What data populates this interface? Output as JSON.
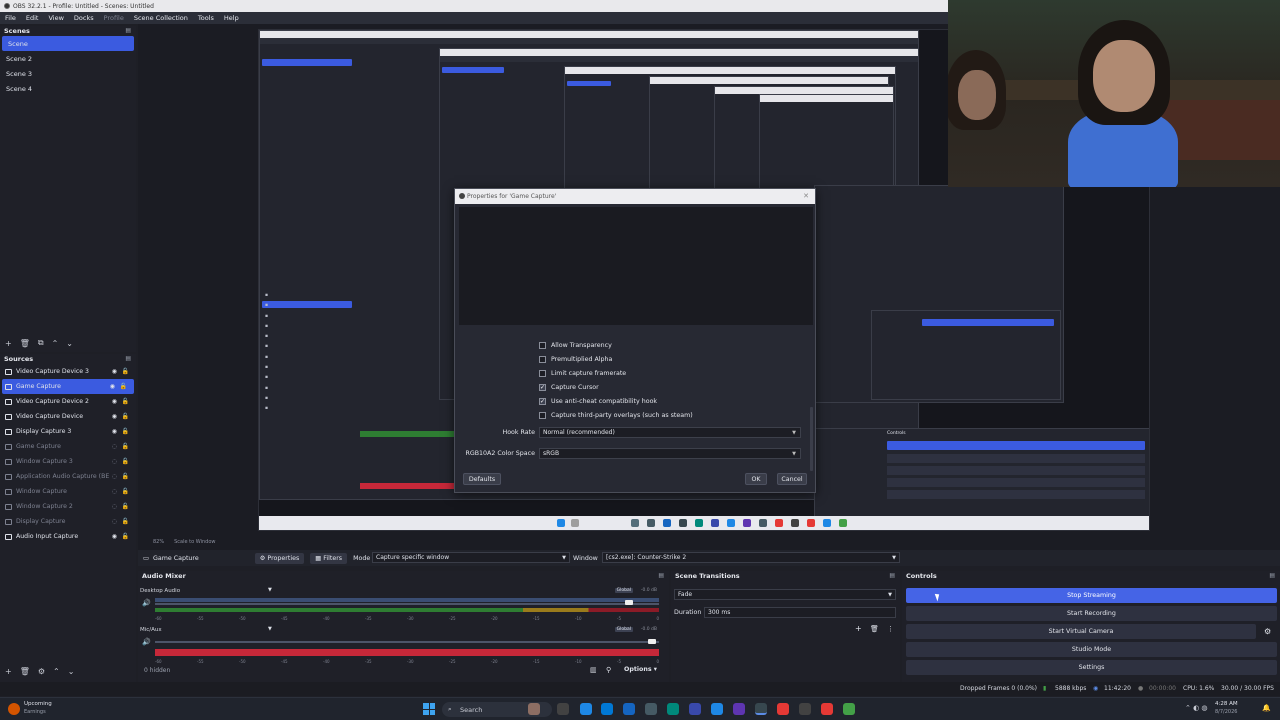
{
  "window": {
    "title": "OBS 32.2.1 - Profile: Untitled - Scenes: Untitled"
  },
  "menu": [
    "File",
    "Edit",
    "View",
    "Docks",
    "Profile",
    "Scene Collection",
    "Tools",
    "Help"
  ],
  "scenes": {
    "title": "Scenes",
    "items": [
      "Scene",
      "Scene 2",
      "Scene 3",
      "Scene 4"
    ],
    "selected": 0
  },
  "sources": {
    "title": "Sources",
    "items": [
      {
        "label": "Video Capture Device 3",
        "visible": true
      },
      {
        "label": "Game Capture",
        "visible": true,
        "selected": true
      },
      {
        "label": "Video Capture Device 2",
        "visible": true
      },
      {
        "label": "Video Capture Device",
        "visible": true
      },
      {
        "label": "Display Capture 3",
        "visible": true
      },
      {
        "label": "Game Capture",
        "visible": false
      },
      {
        "label": "Window Capture 3",
        "visible": false
      },
      {
        "label": "Application Audio Capture (BE",
        "visible": false
      },
      {
        "label": "Window Capture",
        "visible": false
      },
      {
        "label": "Window Capture 2",
        "visible": false
      },
      {
        "label": "Display Capture",
        "visible": false
      },
      {
        "label": "Audio Input Capture",
        "visible": true
      }
    ]
  },
  "dialog": {
    "title": "Properties for 'Game Capture'",
    "checkboxes": [
      {
        "label": "Allow Transparency",
        "checked": false
      },
      {
        "label": "Premultiplied Alpha",
        "checked": false
      },
      {
        "label": "Limit capture framerate",
        "checked": false
      },
      {
        "label": "Capture Cursor",
        "checked": true
      },
      {
        "label": "Use anti-cheat compatibility hook",
        "checked": true
      },
      {
        "label": "Capture third-party overlays (such as steam)",
        "checked": false
      }
    ],
    "hook_rate_label": "Hook Rate",
    "hook_rate_value": "Normal (recommended)",
    "color_space_label": "RGB10A2 Color Space",
    "color_space_value": "sRGB",
    "defaults_label": "Defaults",
    "ok_label": "OK",
    "cancel_label": "Cancel"
  },
  "preview_status": {
    "zoom": "82%",
    "scale": "Scale to Window"
  },
  "source_bar": {
    "source_name": "Game Capture",
    "properties_label": "Properties",
    "filters_label": "Filters",
    "mode_label": "Mode",
    "mode_value": "Capture specific window",
    "window_label": "Window",
    "window_value": "[cs2.exe]: Counter-Strike 2"
  },
  "mixer": {
    "title": "Audio Mixer",
    "channels": [
      {
        "name": "Desktop Audio",
        "db": "-0.0 dB",
        "global": "Global"
      },
      {
        "name": "Mic/Aux",
        "db": "-0.0 dB",
        "global": "Global"
      }
    ],
    "scale": [
      "-60",
      "-55",
      "-50",
      "-45",
      "-40",
      "-35",
      "-30",
      "-25",
      "-20",
      "-15",
      "-10",
      "-5",
      "0"
    ],
    "hidden": "0 hidden",
    "options": "Options"
  },
  "transitions": {
    "title": "Scene Transitions",
    "type": "Fade",
    "duration_label": "Duration",
    "duration_value": "300 ms"
  },
  "controls": {
    "title": "Controls",
    "buttons": [
      "Stop Streaming",
      "Start Recording",
      "Start Virtual Camera",
      "Studio Mode",
      "Settings"
    ]
  },
  "status": {
    "dropped": "Dropped Frames 0 (0.0%)",
    "bitrate": "5888 kbps",
    "stream_time": "11:42:20",
    "rec_time": "00:00:00",
    "cpu": "CPU: 1.6%",
    "fps": "30.00 / 30.00 FPS"
  },
  "taskbar": {
    "weather_title": "Upcoming",
    "weather_sub": "Earnings",
    "search": "Search",
    "time": "4:28 AM",
    "date": "8/7/2026"
  },
  "colors": {
    "accent": "#3b5be0",
    "panel": "#1f2028",
    "meter_green": "#2e7d32",
    "meter_red": "#c62839"
  }
}
